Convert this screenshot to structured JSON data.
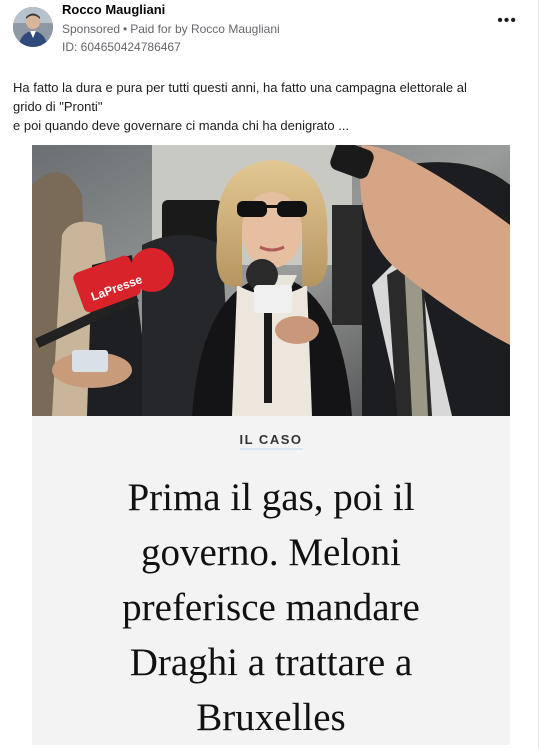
{
  "post": {
    "author": "Rocco Maugliani",
    "sponsored_label": "Sponsored",
    "paid_for_prefix": "Paid for by",
    "paid_for_name": "Rocco Maugliani",
    "ad_id": "ID: 604650424786467",
    "more_icon": "more-horizontal-icon",
    "text_lines": [
      "Ha fatto la dura e pura per tutti questi anni, ha fatto una campagna elettorale al",
      "grido di \"Pronti\"",
      "e poi quando deve governare ci manda chi ha denigrato ..."
    ]
  },
  "creative": {
    "tag": "IL CASO",
    "headline_lines": [
      "Prima il gas, poi il",
      "governo. Meloni",
      "preferisce mandare",
      "Draghi a trattare a",
      "Bruxelles"
    ],
    "mic_brands": [
      "LaPresse",
      "LaPresse"
    ],
    "colors": {
      "mic_red": "#d8232a",
      "band_bg": "#f3f3f3",
      "tag_underline": "#d7e6f2"
    }
  }
}
